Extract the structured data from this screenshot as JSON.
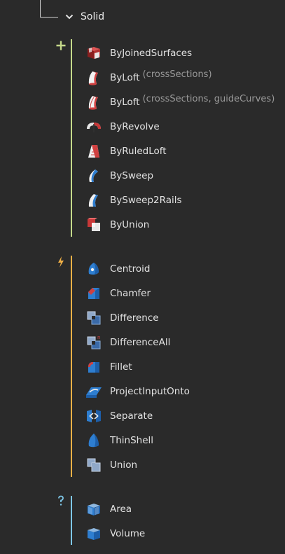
{
  "header": {
    "label": "Solid"
  },
  "colors": {
    "create": "#c5d98a",
    "action": "#f0b046",
    "query": "#7ec6e6"
  },
  "sections": {
    "create": {
      "icon": "plus-icon",
      "items": [
        {
          "label": "ByJoinedSurfaces",
          "params": "",
          "icon": "joined-surfaces-icon"
        },
        {
          "label": "ByLoft",
          "params": "(crossSections)",
          "icon": "loft-icon"
        },
        {
          "label": "ByLoft",
          "params": "(crossSections, guideCurves)",
          "icon": "loft-guides-icon"
        },
        {
          "label": "ByRevolve",
          "params": "",
          "icon": "revolve-icon"
        },
        {
          "label": "ByRuledLoft",
          "params": "",
          "icon": "ruled-loft-icon"
        },
        {
          "label": "BySweep",
          "params": "",
          "icon": "sweep-icon"
        },
        {
          "label": "BySweep2Rails",
          "params": "",
          "icon": "sweep2rails-icon"
        },
        {
          "label": "ByUnion",
          "params": "",
          "icon": "union-create-icon"
        }
      ]
    },
    "action": {
      "icon": "lightning-icon",
      "items": [
        {
          "label": "Centroid",
          "icon": "centroid-icon"
        },
        {
          "label": "Chamfer",
          "icon": "chamfer-icon"
        },
        {
          "label": "Difference",
          "icon": "difference-icon"
        },
        {
          "label": "DifferenceAll",
          "icon": "difference-all-icon"
        },
        {
          "label": "Fillet",
          "icon": "fillet-icon"
        },
        {
          "label": "ProjectInputOnto",
          "icon": "project-input-icon"
        },
        {
          "label": "Separate",
          "icon": "separate-icon"
        },
        {
          "label": "ThinShell",
          "icon": "thinshell-icon"
        },
        {
          "label": "Union",
          "icon": "union-icon"
        }
      ]
    },
    "query": {
      "icon": "question-icon",
      "items": [
        {
          "label": "Area",
          "icon": "area-icon"
        },
        {
          "label": "Volume",
          "icon": "volume-icon"
        }
      ]
    }
  }
}
